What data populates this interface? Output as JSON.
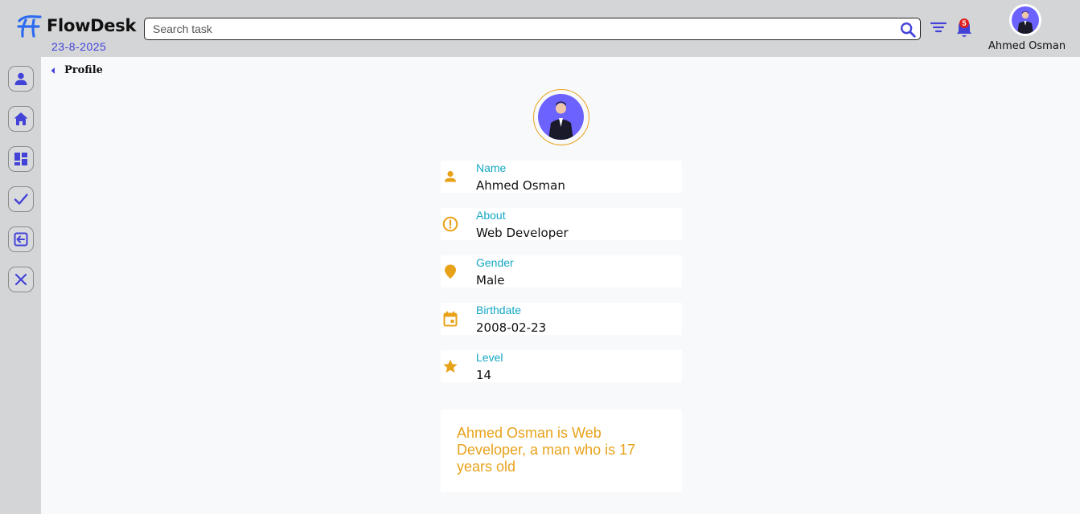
{
  "header": {
    "brand": "FlowDesk",
    "date": "23-8-2025",
    "search_placeholder": "Search task",
    "notification_count": "5",
    "user_name": "Ahmed Osman"
  },
  "sidebar": {
    "items": [
      {
        "icon": "user-icon"
      },
      {
        "icon": "home-icon"
      },
      {
        "icon": "dashboard-icon"
      },
      {
        "icon": "check-icon"
      },
      {
        "icon": "logout-icon"
      },
      {
        "icon": "close-icon"
      }
    ]
  },
  "breadcrumb": {
    "label": "Profile"
  },
  "profile": {
    "fields": [
      {
        "label": "Name",
        "value": "Ahmed Osman",
        "icon": "person-icon"
      },
      {
        "label": "About",
        "value": "Web Developer",
        "icon": "info-icon"
      },
      {
        "label": "Gender",
        "value": "Male",
        "icon": "location-pin-icon"
      },
      {
        "label": "Birthdate",
        "value": "2008-02-23",
        "icon": "calendar-icon"
      },
      {
        "label": "Level",
        "value": "14",
        "icon": "star-icon"
      }
    ],
    "bio": "Ahmed Osman is Web Developer, a man who is 17 years old"
  },
  "colors": {
    "accent": "#4343d8",
    "orange": "#e8a21a",
    "label": "#13a7c4",
    "header_bg": "#d4d5d7"
  }
}
